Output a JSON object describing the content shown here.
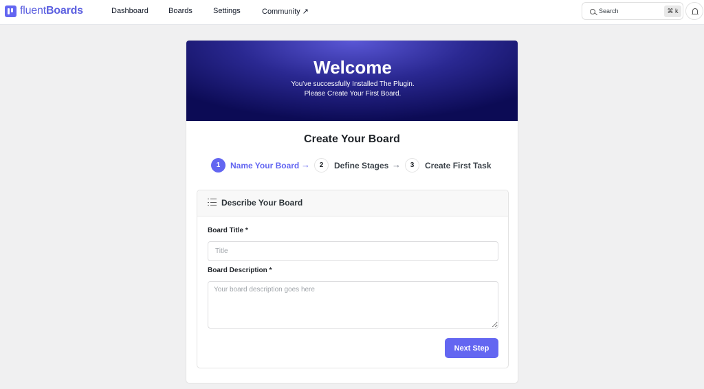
{
  "app": {
    "logo_light": "fluent",
    "logo_bold": "Boards"
  },
  "nav": {
    "items": [
      {
        "label": "Dashboard"
      },
      {
        "label": "Boards"
      },
      {
        "label": "Settings"
      },
      {
        "label": "Community ↗"
      }
    ]
  },
  "search": {
    "label": "Search",
    "shortcut": "⌘ k",
    "icon": "search-icon"
  },
  "notifications": {
    "icon": "bell-icon"
  },
  "hero": {
    "title": "Welcome",
    "line1": "You've successfully Installed The Plugin.",
    "line2": "Please Create Your First Board."
  },
  "wizard": {
    "title": "Create Your Board",
    "steps": [
      {
        "number": "1",
        "label": "Name Your Board",
        "state": "active"
      },
      {
        "number": "2",
        "label": "Define Stages",
        "state": "inactive"
      },
      {
        "number": "3",
        "label": "Create First Task",
        "state": "inactive"
      }
    ],
    "arrow": "→"
  },
  "form": {
    "panel_title": "Describe Your Board",
    "panel_icon": "list-icon",
    "title_label": "Board Title *",
    "title_placeholder": "Title",
    "title_value": "",
    "description_label": "Board Description *",
    "description_placeholder": "Your board description goes here",
    "description_value": "",
    "next_label": "Next Step"
  },
  "colors": {
    "accent": "#6366f1",
    "hero_dark": "#0c0b55",
    "background": "#f0f0f1"
  }
}
